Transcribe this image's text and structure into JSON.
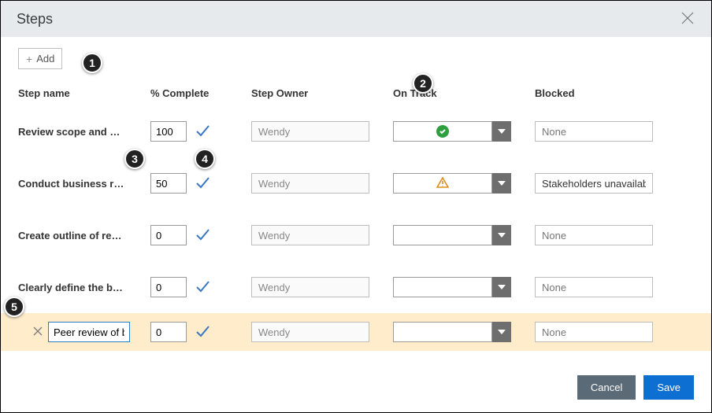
{
  "dialog": {
    "title": "Steps",
    "add_label": "Add",
    "cancel_label": "Cancel",
    "save_label": "Save"
  },
  "headers": {
    "name": "Step name",
    "pct": "% Complete",
    "owner": "Step Owner",
    "track": "On Track",
    "blocked": "Blocked"
  },
  "rows": [
    {
      "name": "Review scope and …",
      "pct": "100",
      "owner": "Wendy",
      "track": "ok",
      "blocked": "None"
    },
    {
      "name": "Conduct business r…",
      "pct": "50",
      "owner": "Wendy",
      "track": "warn",
      "blocked": "Stakeholders unavailable"
    },
    {
      "name": "Create outline of re…",
      "pct": "0",
      "owner": "Wendy",
      "track": "",
      "blocked": "None"
    },
    {
      "name": "Clearly define the b…",
      "pct": "0",
      "owner": "Wendy",
      "track": "",
      "blocked": "None"
    }
  ],
  "new_row": {
    "name": "Peer review of bu",
    "pct": "0",
    "owner": "Wendy",
    "track": "",
    "blocked": "None"
  },
  "callouts": {
    "1": "1",
    "2": "2",
    "3": "3",
    "4": "4",
    "5": "5"
  }
}
